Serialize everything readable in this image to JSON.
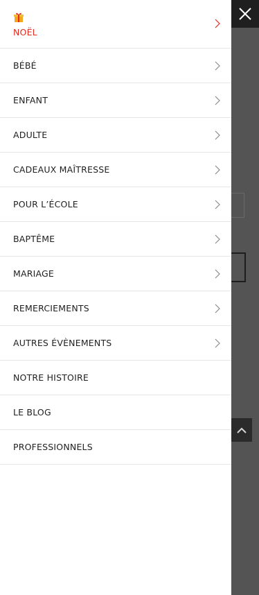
{
  "menu": {
    "items": [
      {
        "label": "NOËL",
        "has_submenu": true,
        "highlight": true,
        "icon": "gift-icon"
      },
      {
        "label": "BÉBÉ",
        "has_submenu": true
      },
      {
        "label": "ENFANT",
        "has_submenu": true
      },
      {
        "label": "ADULTE",
        "has_submenu": true
      },
      {
        "label": "CADEAUX MAÎTRESSE",
        "has_submenu": true
      },
      {
        "label": "POUR L’ÉCOLE",
        "has_submenu": true
      },
      {
        "label": "BAPTÊME",
        "has_submenu": true
      },
      {
        "label": "MARIAGE",
        "has_submenu": true
      },
      {
        "label": "REMERCIEMENTS",
        "has_submenu": true
      },
      {
        "label": "AUTRES ÉVÈNEMENTS",
        "has_submenu": true
      },
      {
        "label": "NOTRE HISTOIRE",
        "has_submenu": false
      },
      {
        "label": "LE BLOG",
        "has_submenu": false
      },
      {
        "label": "PROFESSIONNELS",
        "has_submenu": false
      }
    ]
  },
  "controls": {
    "close_icon": "close-icon",
    "scroll_top_icon": "chevron-up-icon"
  },
  "colors": {
    "highlight": "#e02b1f",
    "text": "#1f1f1f",
    "overlay": "#545454",
    "divider": "#e6e6e6"
  }
}
